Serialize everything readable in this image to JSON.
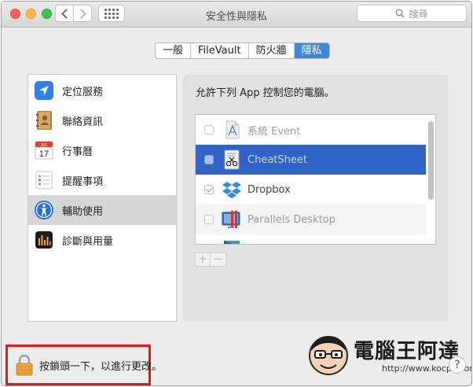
{
  "window": {
    "title": "安全性與隱私",
    "search_placeholder": "搜尋"
  },
  "tabs": [
    {
      "label": "一般",
      "active": false
    },
    {
      "label": "FileVault",
      "active": false
    },
    {
      "label": "防火牆",
      "active": false
    },
    {
      "label": "隱私",
      "active": true
    }
  ],
  "sidebar": {
    "items": [
      {
        "label": "定位服務",
        "icon": "location-arrow-icon",
        "selected": false
      },
      {
        "label": "聯絡資訊",
        "icon": "contacts-book-icon",
        "selected": false
      },
      {
        "label": "行事曆",
        "icon": "calendar-icon",
        "selected": false,
        "icon_text": {
          "month": "JUL",
          "day": "17"
        }
      },
      {
        "label": "提醒事項",
        "icon": "reminders-icon",
        "selected": false
      },
      {
        "label": "輔助使用",
        "icon": "accessibility-icon",
        "selected": true
      },
      {
        "label": "診斷與用量",
        "icon": "diagnostics-icon",
        "selected": false
      }
    ]
  },
  "main": {
    "prompt": "允許下列 App 控制您的電腦。",
    "apps": [
      {
        "label": "系統 Event",
        "icon": "system-events-icon",
        "checked": false,
        "selected": false
      },
      {
        "label": "CheatSheet",
        "icon": "cheatsheet-icon",
        "checked": false,
        "selected": true
      },
      {
        "label": "Dropbox",
        "icon": "dropbox-icon",
        "checked": true,
        "selected": false
      },
      {
        "label": "Parallels Desktop",
        "icon": "parallels-icon",
        "checked": false,
        "selected": false
      }
    ],
    "add_label": "+",
    "remove_label": "−"
  },
  "footer": {
    "lock_text": "按鎖頭一下，以進行更改。",
    "help_label": "?"
  },
  "watermark": {
    "title": "電腦王阿達",
    "url": "http://www.kocpc.com.tw"
  },
  "colors": {
    "selection_blue": "#2f63c6",
    "tab_active": "#3f86e0",
    "highlight_border": "#e21a1a"
  }
}
